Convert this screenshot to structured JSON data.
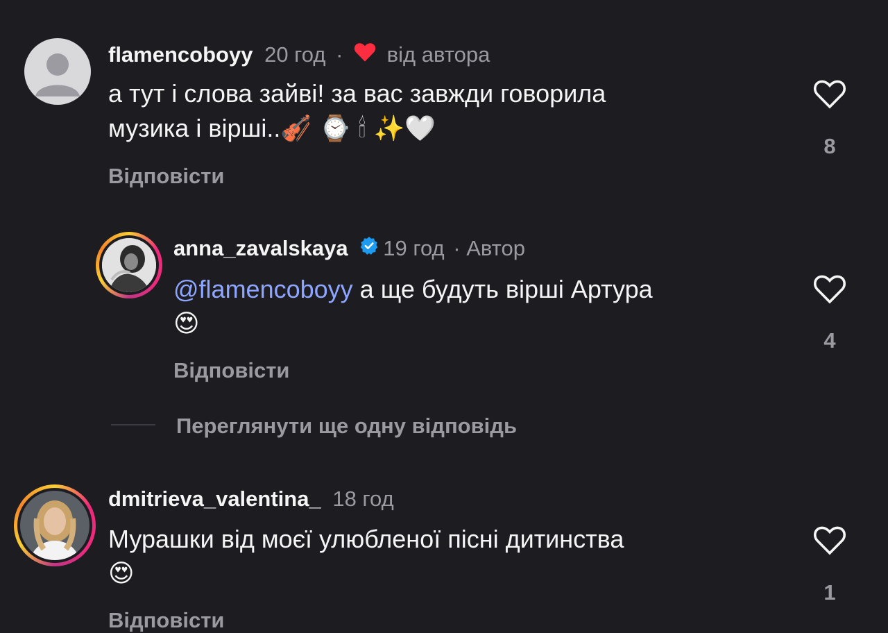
{
  "comments": [
    {
      "username": "flamencoboyy",
      "time": "20 год",
      "separator": "·",
      "badge_text": "від автора",
      "text_line1": "а тут і слова зайві! за вас завжди говорила",
      "text_line2": "музика і вірші..",
      "emojis": "🎻 ⌚ 🕯 ✨🤍",
      "reply_label": "Відповісти",
      "likes": "8"
    },
    {
      "username": "anna_zavalskaya",
      "time": "19 год",
      "separator": "·",
      "role": "Автор",
      "mention": "@flamencoboyy",
      "text": " а ще будуть вірші Артура",
      "emoji": "😍",
      "reply_label": "Відповісти",
      "likes": "4"
    },
    {
      "username": "dmitrieva_valentina_",
      "time": "18 год",
      "text": "Мурашки від моєї улюбленої пісні дитинства",
      "emoji": "😍",
      "reply_label": "Відповісти",
      "likes": "1"
    }
  ],
  "view_more_replies": "Переглянути ще одну відповідь",
  "colors": {
    "background": "#1c1c21",
    "muted": "#9a9aa0",
    "mention": "#8ea6ff",
    "heart": "#ff2d40",
    "verified": "#1d9bf0"
  }
}
